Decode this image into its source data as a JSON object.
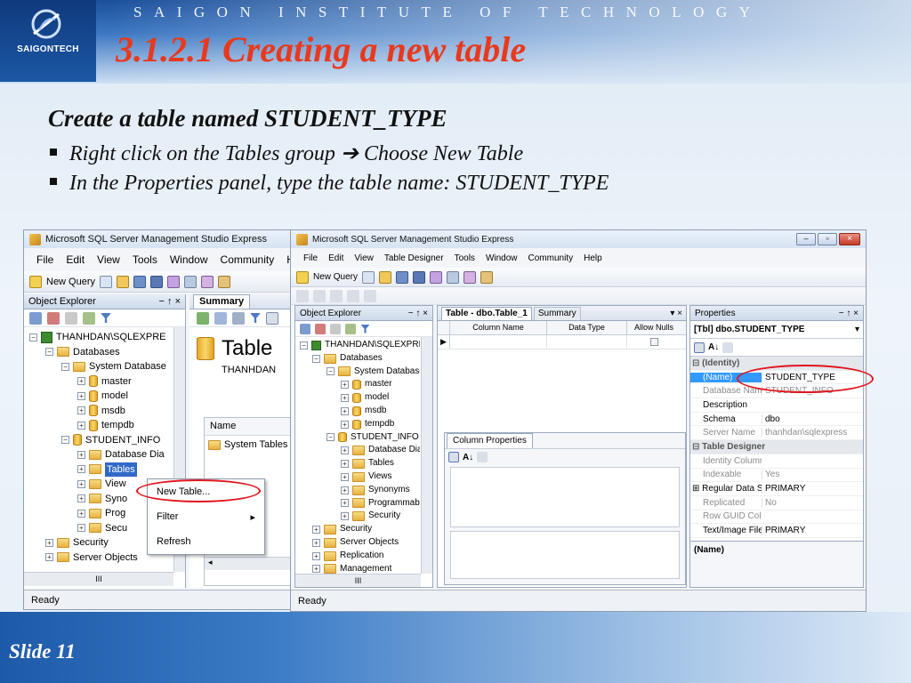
{
  "slide": {
    "institute": "SAIGON INSTITUTE OF TECHNOLOGY",
    "logo_text": "SAIGONTECH",
    "title": "3.1.2.1  Creating a new table",
    "heading": "Create a table named STUDENT_TYPE",
    "bullets": [
      "Right click on the Tables group ➔ Choose New Table",
      "In the Properties panel, type the table name: STUDENT_TYPE"
    ],
    "slide_number": "Slide 11"
  },
  "win1": {
    "title": "Microsoft SQL Server Management Studio Express",
    "menu": [
      "File",
      "Edit",
      "View",
      "Tools",
      "Window",
      "Community",
      "H"
    ],
    "toolbar_new_query": "New Query",
    "explorer_title": "Object Explorer",
    "pin": "− ↑ ×",
    "tree": [
      "THANHDAN\\SQLEXPRE",
      "Databases",
      "System Database",
      "master",
      "model",
      "msdb",
      "tempdb",
      "STUDENT_INFO",
      "Database Dia",
      "Tables",
      "View",
      "Syno",
      "Prog",
      "Secu",
      "Security",
      "Server Objects"
    ],
    "summary_tab": "Summary",
    "summary_big": "Table",
    "summary_server": "THANHDAN",
    "summary_col": "Name",
    "summary_item": "System Tables",
    "scroll_label": "III",
    "status": "Ready",
    "context_menu": [
      "New Table...",
      "Filter",
      "Refresh"
    ]
  },
  "win2": {
    "title": "Microsoft SQL Server Management Studio Express",
    "menu": [
      "File",
      "Edit",
      "View",
      "Table Designer",
      "Tools",
      "Window",
      "Community",
      "Help"
    ],
    "toolbar_new_query": "New Query",
    "explorer_title": "Object Explorer",
    "pin": "− ↑ ×",
    "tree": [
      "THANHDAN\\SQLEXPRE",
      "Databases",
      "System Database",
      "master",
      "model",
      "msdb",
      "tempdb",
      "STUDENT_INFO",
      "Database Dia",
      "Tables",
      "Views",
      "Synonyms",
      "Programmab",
      "Security",
      "Security",
      "Server Objects",
      "Replication",
      "Management"
    ],
    "designer_tab": "Table - dbo.Table_1",
    "summary_tab": "Summary",
    "grid_headers": [
      "Column Name",
      "Data Type",
      "Allow Nulls"
    ],
    "column_props_tab": "Column Properties",
    "scroll_label": "III",
    "status": "Ready",
    "properties": {
      "title": "Properties",
      "object": "[Tbl] dbo.STUDENT_TYPE",
      "rows": [
        {
          "k": "(Identity)",
          "v": "",
          "cat": true
        },
        {
          "k": "(Name)",
          "v": "STUDENT_TYPE"
        },
        {
          "k": "Database Name",
          "v": "STUDENT_INFO",
          "gray": true
        },
        {
          "k": "Description",
          "v": ""
        },
        {
          "k": "Schema",
          "v": "dbo"
        },
        {
          "k": "Server Name",
          "v": "thanhdan\\sqlexpress",
          "gray": true
        },
        {
          "k": "Table Designer",
          "v": "",
          "cat": true
        },
        {
          "k": "Identity Column",
          "v": "",
          "gray": true
        },
        {
          "k": "Indexable",
          "v": "Yes",
          "gray": true
        },
        {
          "k": "Regular Data Spa",
          "v": "PRIMARY",
          "expander": true
        },
        {
          "k": "Replicated",
          "v": "No",
          "gray": true
        },
        {
          "k": "Row GUID Colum",
          "v": "",
          "gray": true
        },
        {
          "k": "Text/Image Filegr",
          "v": "PRIMARY"
        }
      ],
      "footer": "(Name)"
    }
  },
  "colors": {
    "title_red": "#e8391d",
    "highlight_red": "#e2141e",
    "selection_blue": "#3399ff"
  }
}
